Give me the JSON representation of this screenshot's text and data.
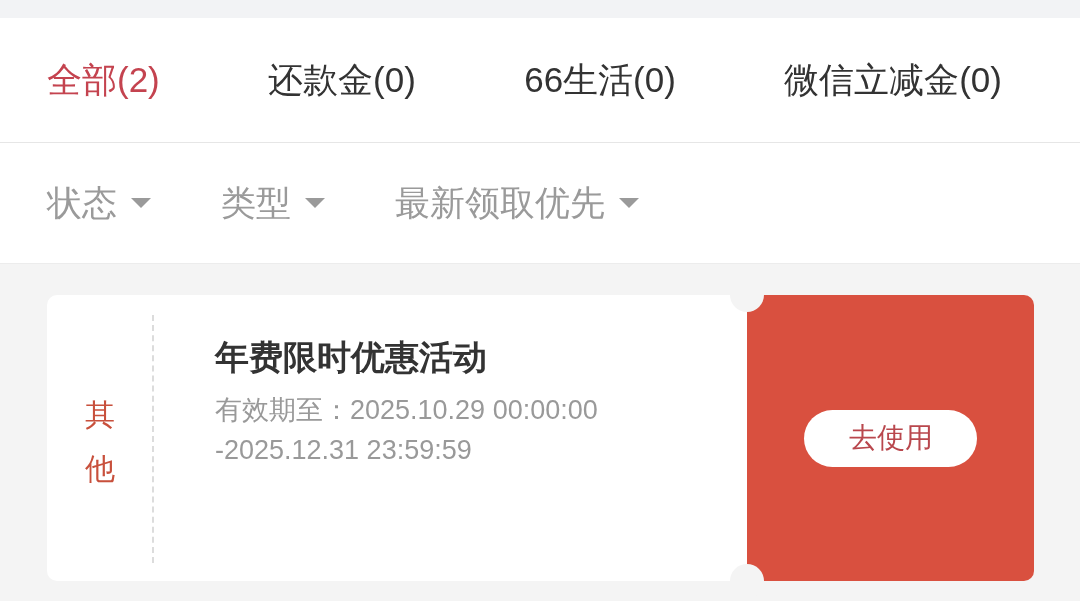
{
  "tabs": [
    {
      "label": "全部(2)",
      "selected": true
    },
    {
      "label": "还款金(0)",
      "selected": false
    },
    {
      "label": "66生活(0)",
      "selected": false
    },
    {
      "label": "微信立减金(0)",
      "selected": false
    }
  ],
  "filters": [
    {
      "label": "状态"
    },
    {
      "label": "类型"
    },
    {
      "label": "最新领取优先"
    }
  ],
  "coupons": [
    {
      "category": "其他",
      "title": "年费限时优惠活动",
      "validity": "有效期至：2025.10.29 00:00:00\n-2025.12.31 23:59:59",
      "action": "去使用"
    }
  ]
}
